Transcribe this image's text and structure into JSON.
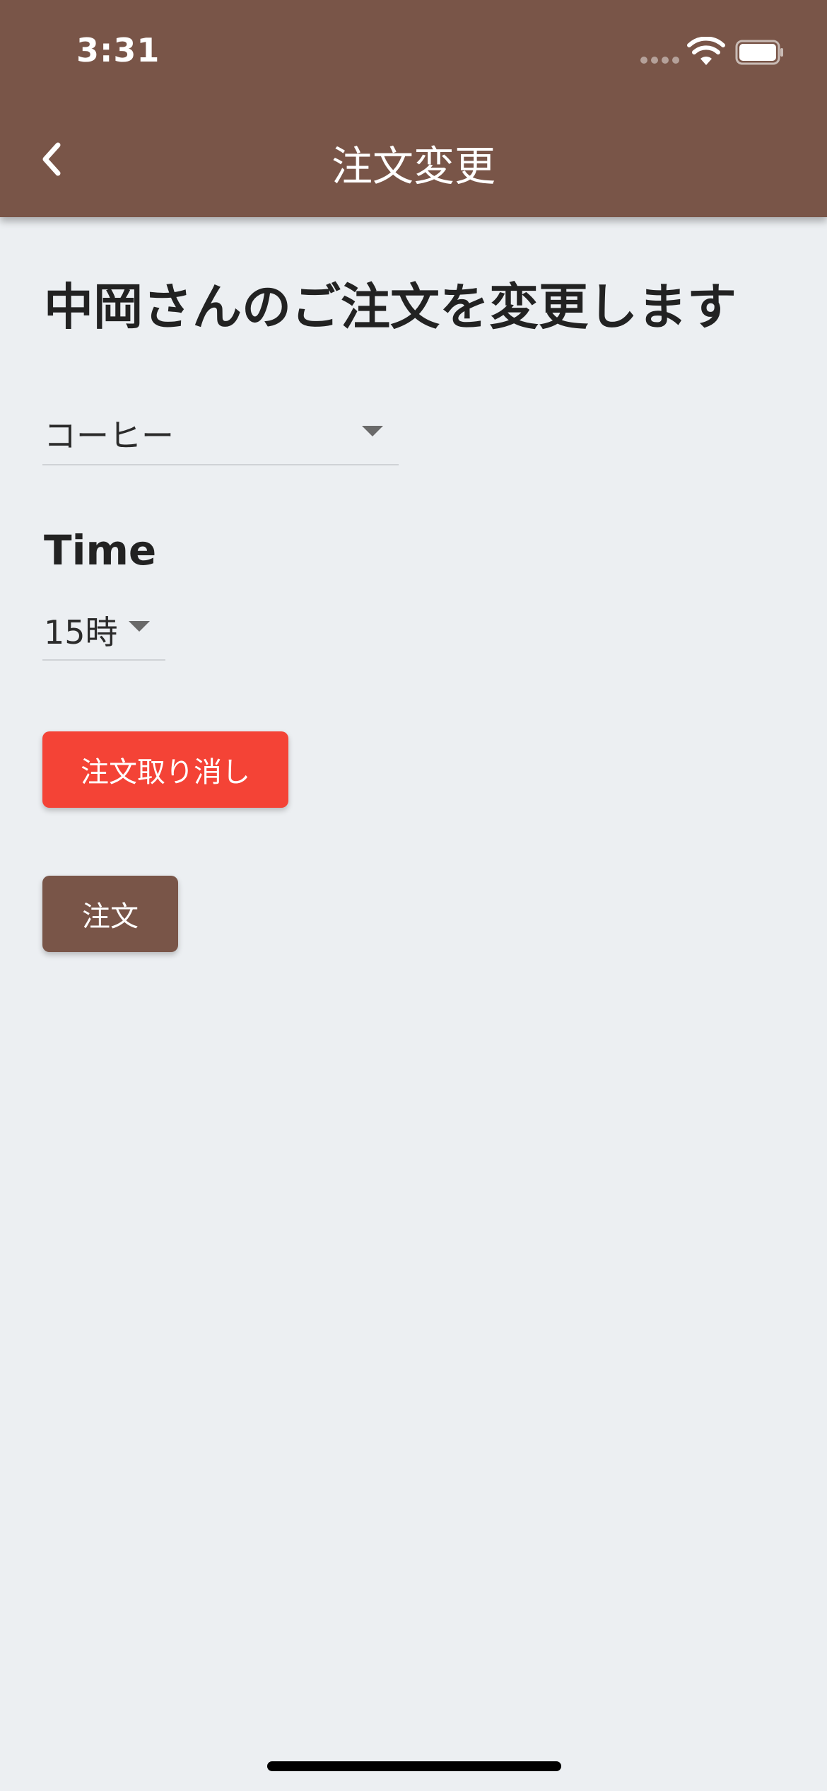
{
  "status_bar": {
    "time": "3:31"
  },
  "app_bar": {
    "title": "注文変更",
    "back_icon": "chevron-left-icon",
    "background": "#795548"
  },
  "main": {
    "heading": "中岡さんのご注文を変更します",
    "product_select": {
      "value": "コーヒー"
    },
    "time_section": {
      "label": "Time",
      "select_value": "15時"
    },
    "cancel_button": {
      "label": "注文取り消し",
      "color": "#f44336"
    },
    "order_button": {
      "label": "注文",
      "color": "#795548"
    }
  },
  "colors": {
    "background": "#eceff2",
    "text": "#222222"
  }
}
